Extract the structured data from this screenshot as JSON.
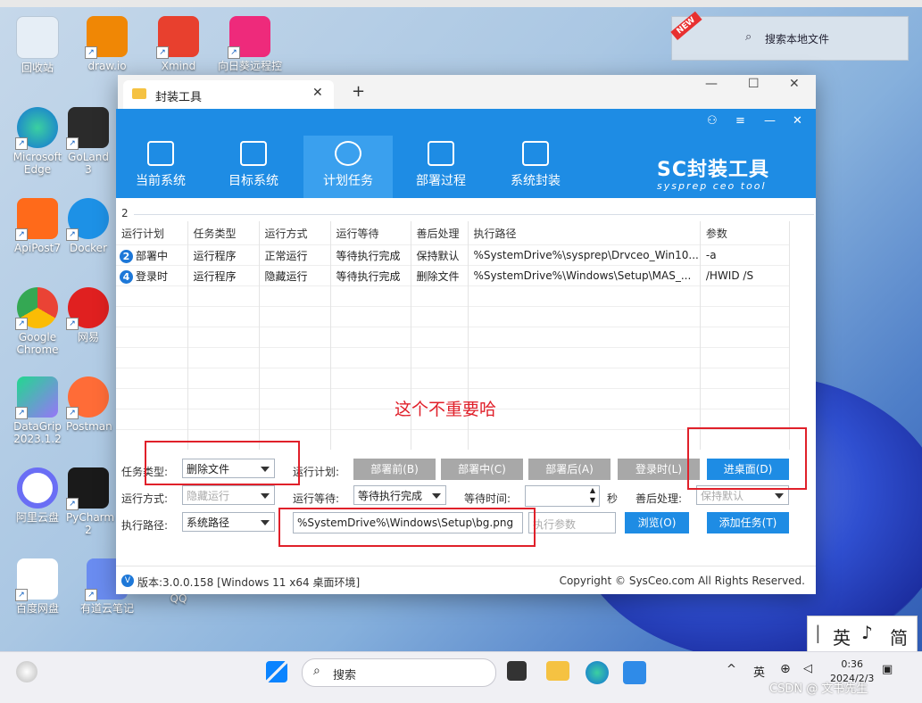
{
  "desktop": {
    "icons": [
      {
        "label": "回收站"
      },
      {
        "label": "draw.io"
      },
      {
        "label": "Xmind"
      },
      {
        "label": "向日葵远程控"
      },
      {
        "label": "Microsoft Edge"
      },
      {
        "label": "GoLand 3"
      },
      {
        "label": "ApiPost7"
      },
      {
        "label": "Docker"
      },
      {
        "label": "Google Chrome"
      },
      {
        "label": "网易"
      },
      {
        "label": "DataGrip 2023.1.2"
      },
      {
        "label": "Postman"
      },
      {
        "label": "阿里云盘"
      },
      {
        "label": "PyCharm 2"
      },
      {
        "label": "百度网盘"
      },
      {
        "label": "有道云笔记"
      },
      {
        "label": "QQ"
      }
    ],
    "search_widget": {
      "label": "搜索本地文件",
      "ribbon": "NEW"
    }
  },
  "window": {
    "tab_title": "封装工具",
    "close_tab": "✕",
    "new_tab": "+",
    "minimize": "—",
    "maximize": "☐",
    "close": "✕"
  },
  "app": {
    "nav": [
      {
        "label": "当前系统",
        "icon": "windows-icon"
      },
      {
        "label": "目标系统",
        "icon": "monitor-icon"
      },
      {
        "label": "计划任务",
        "icon": "clock-icon",
        "active": true
      },
      {
        "label": "部署过程",
        "icon": "grid-icon"
      },
      {
        "label": "系统封装",
        "icon": "box-icon"
      }
    ],
    "brand_main": "SC封装工具",
    "brand_sub": "sysprep ceo tool",
    "group_number": "2",
    "table": {
      "headers": [
        "运行计划",
        "任务类型",
        "运行方式",
        "运行等待",
        "善后处理",
        "执行路径",
        "参数"
      ],
      "rows": [
        {
          "num": "2",
          "plan": "部署中",
          "type": "运行程序",
          "mode": "正常运行",
          "wait": "等待执行完成",
          "after": "保持默认",
          "path": "%SystemDrive%\\sysprep\\Drvceo_Win10...",
          "params": "-a"
        },
        {
          "num": "4",
          "plan": "登录时",
          "type": "运行程序",
          "mode": "隐藏运行",
          "wait": "等待执行完成",
          "after": "删除文件",
          "path": "%SystemDrive%\\Windows\\Setup\\MAS_...",
          "params": "/HWID /S"
        }
      ]
    },
    "annotation": "这个不重要哈",
    "form": {
      "task_type_label": "任务类型:",
      "task_type_value": "删除文件",
      "run_plan_label": "运行计划:",
      "plan_buttons": [
        "部署前(B)",
        "部署中(C)",
        "部署后(A)",
        "登录时(L)"
      ],
      "enter_desktop_button": "进桌面(D)",
      "run_mode_label": "运行方式:",
      "run_mode_value": "隐藏运行",
      "run_wait_label": "运行等待:",
      "run_wait_value": "等待执行完成",
      "wait_time_label": "等待时间:",
      "wait_time_unit": "秒",
      "after_label": "善后处理:",
      "after_value": "保持默认",
      "exec_path_label": "执行路径:",
      "exec_path_type": "系统路径",
      "exec_path_value": "%SystemDrive%\\Windows\\Setup\\bg.png",
      "params_placeholder": "执行参数",
      "browse_button": "浏览(O)",
      "add_task_button": "添加任务(T)"
    },
    "footer": {
      "version": "版本:3.0.0.158 [Windows 11 x64 桌面环境]",
      "copyright": "Copyright © SysCeo.com All Rights Reserved."
    }
  },
  "taskbar": {
    "search_label": "搜索",
    "lang": "英",
    "time": "0:36",
    "date": "2024/2/3",
    "ime_items": [
      "英",
      "简"
    ],
    "watermark": "CSDN @ 文书先生"
  }
}
